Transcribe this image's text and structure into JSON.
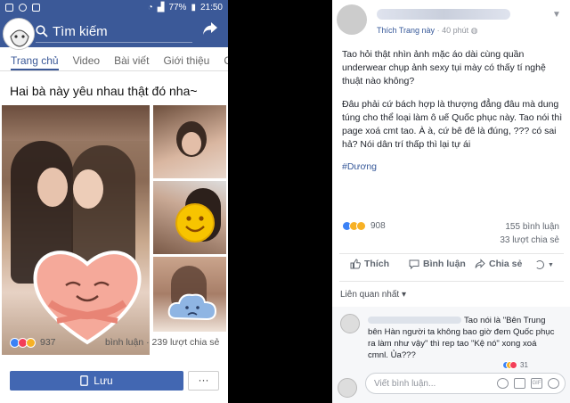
{
  "left_phone": {
    "status": {
      "battery": "77%",
      "time": "21:50"
    },
    "search": {
      "placeholder": "Tìm kiếm"
    },
    "tabs": [
      "Trang chủ",
      "Video",
      "Bài viết",
      "Giới thiệu",
      "Cộ"
    ],
    "post_title": "Hai bà này yêu nhau thật đó nha~",
    "reaction_count": "937",
    "stats": "bình luận · 239 lượt chia sẻ",
    "save_label": "Lưu",
    "more_label": "···"
  },
  "right_post": {
    "meta": {
      "source": "Thích Trang này",
      "time": "40 phút"
    },
    "body": [
      "Tao hỏi thật nhìn ảnh mặc áo dài cùng quần underwear chụp ảnh sexy tụi mày có thấy tí nghệ thuật nào không?",
      "Đâu phải cứ bách hợp là thượng đẳng đâu mà dung túng cho thể loại làm ô uế Quốc phục này. Tao nói thì page xoá cmt tao. À à, cứ bê đê là đúng, ??? có sai hả? Nói dân trí thấp thì lại tự ái"
    ],
    "hashtag": "#Dương",
    "reaction_count": "908",
    "comment_count": "155 bình luận",
    "share_count": "33 lượt chia sẻ",
    "actions": [
      "Thích",
      "Bình luận",
      "Chia sẻ"
    ],
    "relevant": "Liên quan nhất ▾",
    "comment": {
      "text_pre": "Tao nói là \"Bên",
      "text_rest": "Trung bên Hàn người ta không bao giờ đem Quốc phục ra làm như vậy\" thì rep tao \"Kệ nó\" xong xoá cmnl. Ủa???",
      "react_count": "31"
    },
    "write_placeholder": "Viết bình luận..."
  },
  "colors": {
    "fb_blue": "#3b5998",
    "button_blue": "#4267b2",
    "link_blue": "#365899"
  }
}
